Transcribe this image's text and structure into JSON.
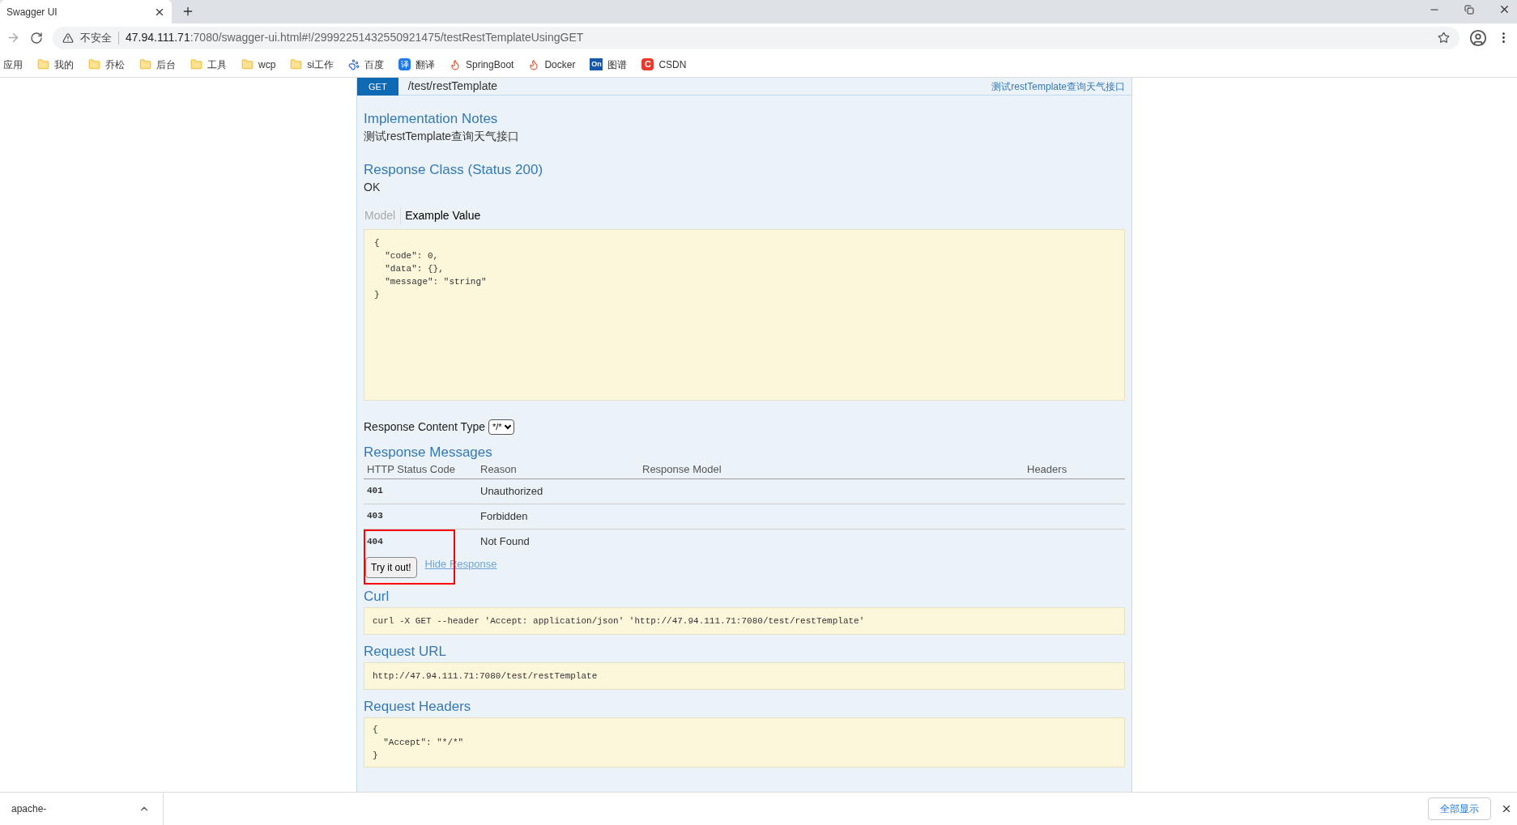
{
  "browser": {
    "tabs": [
      {
        "title": "Swagger UI",
        "selected": true
      }
    ],
    "address": {
      "security_label": "不安全",
      "host": "47.94.111.71",
      "rest": ":7080/swagger-ui.html#!/29992251432550921475/testRestTemplateUsingGET"
    },
    "bookmarks": [
      {
        "label": "应用",
        "kind": "text"
      },
      {
        "label": "我的",
        "kind": "folder"
      },
      {
        "label": "乔松",
        "kind": "folder"
      },
      {
        "label": "后台",
        "kind": "folder"
      },
      {
        "label": "工具",
        "kind": "folder"
      },
      {
        "label": "wcp",
        "kind": "folder"
      },
      {
        "label": "si工作",
        "kind": "folder"
      },
      {
        "label": "百度",
        "kind": "paw"
      },
      {
        "label": "翻译",
        "kind": "translate",
        "icon_text": "译"
      },
      {
        "label": "SpringBoot",
        "kind": "flame"
      },
      {
        "label": "Docker",
        "kind": "flame"
      },
      {
        "label": "图谱",
        "kind": "badge",
        "icon_text": "On"
      },
      {
        "label": "CSDN",
        "kind": "csdn",
        "icon_text": "C"
      }
    ]
  },
  "operation": {
    "method": "GET",
    "path": "/test/restTemplate",
    "summary": "测试restTemplate查询天气接口",
    "implementation_notes": {
      "title": "Implementation Notes",
      "text": "测试restTemplate查询天气接口"
    },
    "response_class": {
      "title": "Response Class (Status 200)",
      "text": "OK"
    },
    "model_tabs": [
      {
        "label": "Model",
        "selected": false
      },
      {
        "label": "Example Value",
        "selected": true
      }
    ],
    "example_value": [
      "{",
      "  \"code\": 0,",
      "  \"data\": {},",
      "  \"message\": \"string\"",
      "}"
    ],
    "content_type": {
      "label": "Response Content Type",
      "value": "*/*"
    },
    "response_messages": {
      "title": "Response Messages",
      "columns": [
        "HTTP Status Code",
        "Reason",
        "Response Model",
        "Headers"
      ],
      "rows": [
        {
          "code": "401",
          "reason": "Unauthorized"
        },
        {
          "code": "403",
          "reason": "Forbidden"
        },
        {
          "code": "404",
          "reason": "Not Found"
        }
      ]
    },
    "try_button": "Try it out!",
    "hide_link": "Hide Response",
    "curl": {
      "title": "Curl",
      "text": "curl -X GET --header 'Accept: application/json' 'http://47.94.111.71:7080/test/restTemplate'"
    },
    "request_url": {
      "title": "Request URL",
      "text": "http://47.94.111.71:7080/test/restTemplate"
    },
    "request_headers": {
      "title": "Request Headers",
      "lines": [
        "{",
        "  \"Accept\": \"*/*\"",
        "}"
      ]
    }
  },
  "downloads": {
    "file": "apache-",
    "show_all": "全部显示"
  }
}
